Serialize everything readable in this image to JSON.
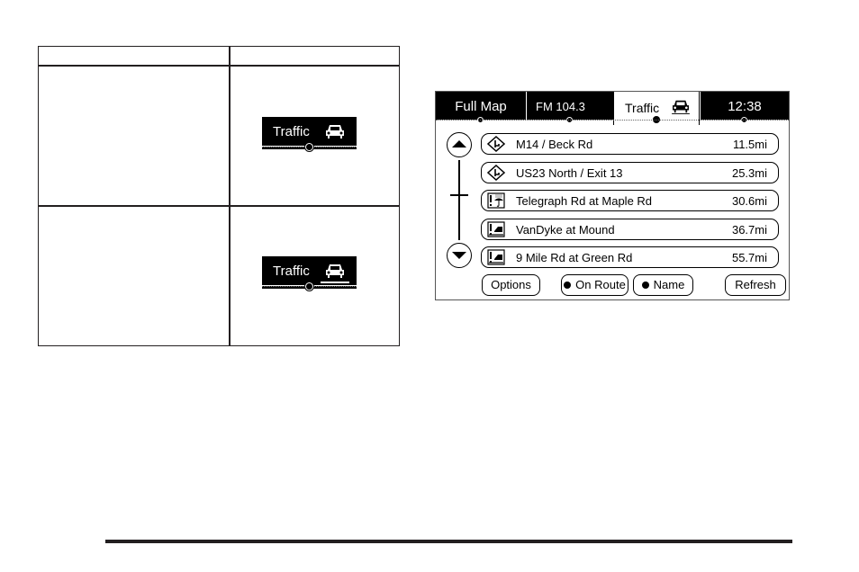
{
  "table": {
    "rows": [
      {
        "description": "",
        "icon": {
          "label": "Traffic",
          "glyph": "car-icon",
          "underlined": false
        }
      },
      {
        "description": "",
        "icon": {
          "label": "Traffic",
          "glyph": "car-icon",
          "underlined": true
        }
      }
    ]
  },
  "screen": {
    "tabs": [
      {
        "label": "Full Map",
        "active": false
      },
      {
        "label": "FM 104.3",
        "active": false
      },
      {
        "label": "Traffic",
        "active": true,
        "icon": "car-icon"
      },
      {
        "label": "12:38",
        "active": false
      }
    ],
    "incidents": [
      {
        "name": "M14 / Beck Rd",
        "distance": "11.5mi",
        "icon": "road-sign-icon"
      },
      {
        "name": "US23 North / Exit 13",
        "distance": "25.3mi",
        "icon": "road-sign-icon"
      },
      {
        "name": "Telegraph Rd at Maple Rd",
        "distance": "30.6mi",
        "icon": "weather-warning-icon"
      },
      {
        "name": "VanDyke at Mound",
        "distance": "36.7mi",
        "icon": "accident-icon"
      },
      {
        "name": "9 Mile Rd at Green Rd",
        "distance": "55.7mi",
        "icon": "accident-icon"
      }
    ],
    "buttons": {
      "options": "Options",
      "on_route": "On Route",
      "name": "Name",
      "refresh": "Refresh"
    }
  }
}
